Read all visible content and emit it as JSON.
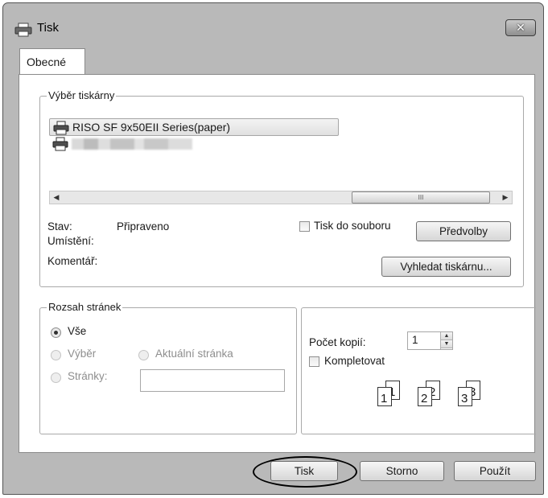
{
  "window": {
    "title": "Tisk",
    "close_glyph": "✕"
  },
  "tabs": [
    {
      "label": "Obecné"
    }
  ],
  "printer_group": {
    "legend": "Výběr tiskárny",
    "printers": [
      {
        "name": "RISO SF 9x50EII Series(paper)",
        "selected": true
      },
      {
        "name": "",
        "selected": false
      }
    ],
    "scroll_thumb_glyph": "III",
    "status_label": "Stav:",
    "status_value": "Připraveno",
    "location_label": "Umístění:",
    "comment_label": "Komentář:",
    "print_to_file_label": "Tisk do souboru",
    "preferences_button": "Předvolby",
    "find_printer_button": "Vyhledat tiskárnu..."
  },
  "range_group": {
    "legend": "Rozsah stránek",
    "all_label": "Vše",
    "selection_label": "Výběr",
    "current_page_label": "Aktuální stránka",
    "pages_label": "Stránky:",
    "pages_value": ""
  },
  "copies": {
    "label": "Počet kopií:",
    "value": "1",
    "collate_label": "Kompletovat",
    "collate_pages": [
      "1",
      "1",
      "2",
      "2",
      "3",
      "3"
    ]
  },
  "footer": {
    "print_button": "Tisk",
    "cancel_button": "Storno",
    "apply_button": "Použít"
  }
}
